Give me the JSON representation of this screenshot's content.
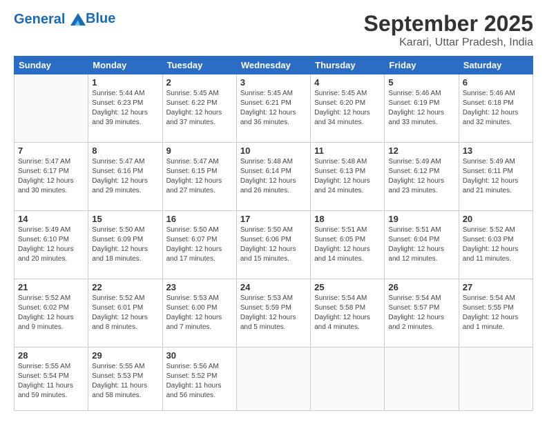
{
  "header": {
    "logo_line1": "General",
    "logo_line2": "Blue",
    "month": "September 2025",
    "location": "Karari, Uttar Pradesh, India"
  },
  "days_of_week": [
    "Sunday",
    "Monday",
    "Tuesday",
    "Wednesday",
    "Thursday",
    "Friday",
    "Saturday"
  ],
  "weeks": [
    [
      {
        "day": "",
        "info": ""
      },
      {
        "day": "1",
        "info": "Sunrise: 5:44 AM\nSunset: 6:23 PM\nDaylight: 12 hours\nand 39 minutes."
      },
      {
        "day": "2",
        "info": "Sunrise: 5:45 AM\nSunset: 6:22 PM\nDaylight: 12 hours\nand 37 minutes."
      },
      {
        "day": "3",
        "info": "Sunrise: 5:45 AM\nSunset: 6:21 PM\nDaylight: 12 hours\nand 36 minutes."
      },
      {
        "day": "4",
        "info": "Sunrise: 5:45 AM\nSunset: 6:20 PM\nDaylight: 12 hours\nand 34 minutes."
      },
      {
        "day": "5",
        "info": "Sunrise: 5:46 AM\nSunset: 6:19 PM\nDaylight: 12 hours\nand 33 minutes."
      },
      {
        "day": "6",
        "info": "Sunrise: 5:46 AM\nSunset: 6:18 PM\nDaylight: 12 hours\nand 32 minutes."
      }
    ],
    [
      {
        "day": "7",
        "info": "Sunrise: 5:47 AM\nSunset: 6:17 PM\nDaylight: 12 hours\nand 30 minutes."
      },
      {
        "day": "8",
        "info": "Sunrise: 5:47 AM\nSunset: 6:16 PM\nDaylight: 12 hours\nand 29 minutes."
      },
      {
        "day": "9",
        "info": "Sunrise: 5:47 AM\nSunset: 6:15 PM\nDaylight: 12 hours\nand 27 minutes."
      },
      {
        "day": "10",
        "info": "Sunrise: 5:48 AM\nSunset: 6:14 PM\nDaylight: 12 hours\nand 26 minutes."
      },
      {
        "day": "11",
        "info": "Sunrise: 5:48 AM\nSunset: 6:13 PM\nDaylight: 12 hours\nand 24 minutes."
      },
      {
        "day": "12",
        "info": "Sunrise: 5:49 AM\nSunset: 6:12 PM\nDaylight: 12 hours\nand 23 minutes."
      },
      {
        "day": "13",
        "info": "Sunrise: 5:49 AM\nSunset: 6:11 PM\nDaylight: 12 hours\nand 21 minutes."
      }
    ],
    [
      {
        "day": "14",
        "info": "Sunrise: 5:49 AM\nSunset: 6:10 PM\nDaylight: 12 hours\nand 20 minutes."
      },
      {
        "day": "15",
        "info": "Sunrise: 5:50 AM\nSunset: 6:09 PM\nDaylight: 12 hours\nand 18 minutes."
      },
      {
        "day": "16",
        "info": "Sunrise: 5:50 AM\nSunset: 6:07 PM\nDaylight: 12 hours\nand 17 minutes."
      },
      {
        "day": "17",
        "info": "Sunrise: 5:50 AM\nSunset: 6:06 PM\nDaylight: 12 hours\nand 15 minutes."
      },
      {
        "day": "18",
        "info": "Sunrise: 5:51 AM\nSunset: 6:05 PM\nDaylight: 12 hours\nand 14 minutes."
      },
      {
        "day": "19",
        "info": "Sunrise: 5:51 AM\nSunset: 6:04 PM\nDaylight: 12 hours\nand 12 minutes."
      },
      {
        "day": "20",
        "info": "Sunrise: 5:52 AM\nSunset: 6:03 PM\nDaylight: 12 hours\nand 11 minutes."
      }
    ],
    [
      {
        "day": "21",
        "info": "Sunrise: 5:52 AM\nSunset: 6:02 PM\nDaylight: 12 hours\nand 9 minutes."
      },
      {
        "day": "22",
        "info": "Sunrise: 5:52 AM\nSunset: 6:01 PM\nDaylight: 12 hours\nand 8 minutes."
      },
      {
        "day": "23",
        "info": "Sunrise: 5:53 AM\nSunset: 6:00 PM\nDaylight: 12 hours\nand 7 minutes."
      },
      {
        "day": "24",
        "info": "Sunrise: 5:53 AM\nSunset: 5:59 PM\nDaylight: 12 hours\nand 5 minutes."
      },
      {
        "day": "25",
        "info": "Sunrise: 5:54 AM\nSunset: 5:58 PM\nDaylight: 12 hours\nand 4 minutes."
      },
      {
        "day": "26",
        "info": "Sunrise: 5:54 AM\nSunset: 5:57 PM\nDaylight: 12 hours\nand 2 minutes."
      },
      {
        "day": "27",
        "info": "Sunrise: 5:54 AM\nSunset: 5:55 PM\nDaylight: 12 hours\nand 1 minute."
      }
    ],
    [
      {
        "day": "28",
        "info": "Sunrise: 5:55 AM\nSunset: 5:54 PM\nDaylight: 11 hours\nand 59 minutes."
      },
      {
        "day": "29",
        "info": "Sunrise: 5:55 AM\nSunset: 5:53 PM\nDaylight: 11 hours\nand 58 minutes."
      },
      {
        "day": "30",
        "info": "Sunrise: 5:56 AM\nSunset: 5:52 PM\nDaylight: 11 hours\nand 56 minutes."
      },
      {
        "day": "",
        "info": ""
      },
      {
        "day": "",
        "info": ""
      },
      {
        "day": "",
        "info": ""
      },
      {
        "day": "",
        "info": ""
      }
    ]
  ]
}
